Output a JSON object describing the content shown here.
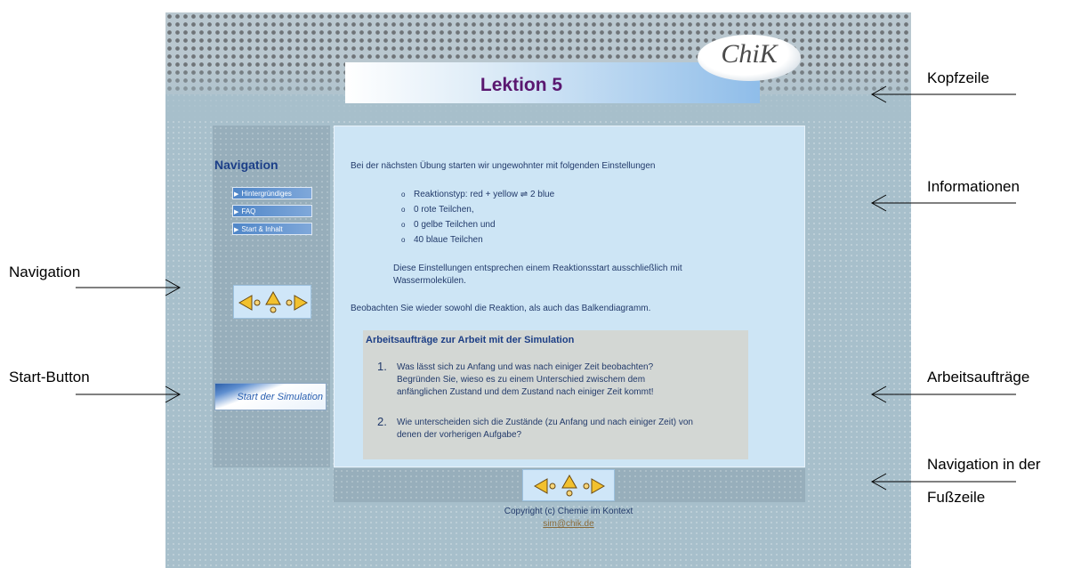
{
  "header": {
    "title": "Lektion 5",
    "logo_text": "ChiK"
  },
  "navigation": {
    "title": "Navigation",
    "items": [
      {
        "label": "Hintergründiges"
      },
      {
        "label": "FAQ"
      },
      {
        "label": "Start & Inhalt"
      }
    ],
    "start_button": "Start der Simulation"
  },
  "content": {
    "intro": "Bei der nächsten Übung starten wir ungewohnter mit folgenden Einstellungen",
    "settings": [
      "Reaktionstyp: red + yellow ⇌ 2 blue",
      "0 rote Teilchen,",
      "0 gelbe Teilchen und",
      "40 blaue Teilchen"
    ],
    "note_line1": "Diese Einstellungen entsprechen einem Reaktionsstart ausschließlich mit",
    "note_line2": "Wassermolekülen.",
    "observe": "Beobachten Sie wieder sowohl die Reaktion, als auch das Balkendiagramm.",
    "tasks": {
      "title": "Arbeitsaufträge zur Arbeit mit der Simulation",
      "items": [
        {
          "num": "1.",
          "lines": [
            "Was lässt sich zu Anfang und was nach einiger Zeit beobachten?",
            "Begründen Sie, wieso es zu einem Unterschied zwischem dem",
            "anfänglichen Zustand und dem Zustand nach einiger Zeit kommt!"
          ]
        },
        {
          "num": "2.",
          "lines": [
            "Wie unterscheiden sich die Zustände (zu Anfang und nach einiger Zeit) von",
            "denen der vorherigen Aufgabe?"
          ]
        }
      ]
    }
  },
  "footer": {
    "copyright": "Copyright (c) Chemie im Kontext",
    "email": "sim@chik.de"
  },
  "annotations": {
    "kopfzeile": "Kopfzeile",
    "informationen": "Informationen",
    "navigation": "Navigation",
    "start_button": "Start-Button",
    "arbeitsauftraege": "Arbeitsaufträge",
    "fusszeile_line1": "Navigation in der",
    "fusszeile_line2": "Fußzeile"
  },
  "colors": {
    "title": "#5a1770",
    "nav_title": "#1c3f88",
    "arrow_fill": "#f2c12e",
    "page_bg": "#a7bfcb"
  }
}
